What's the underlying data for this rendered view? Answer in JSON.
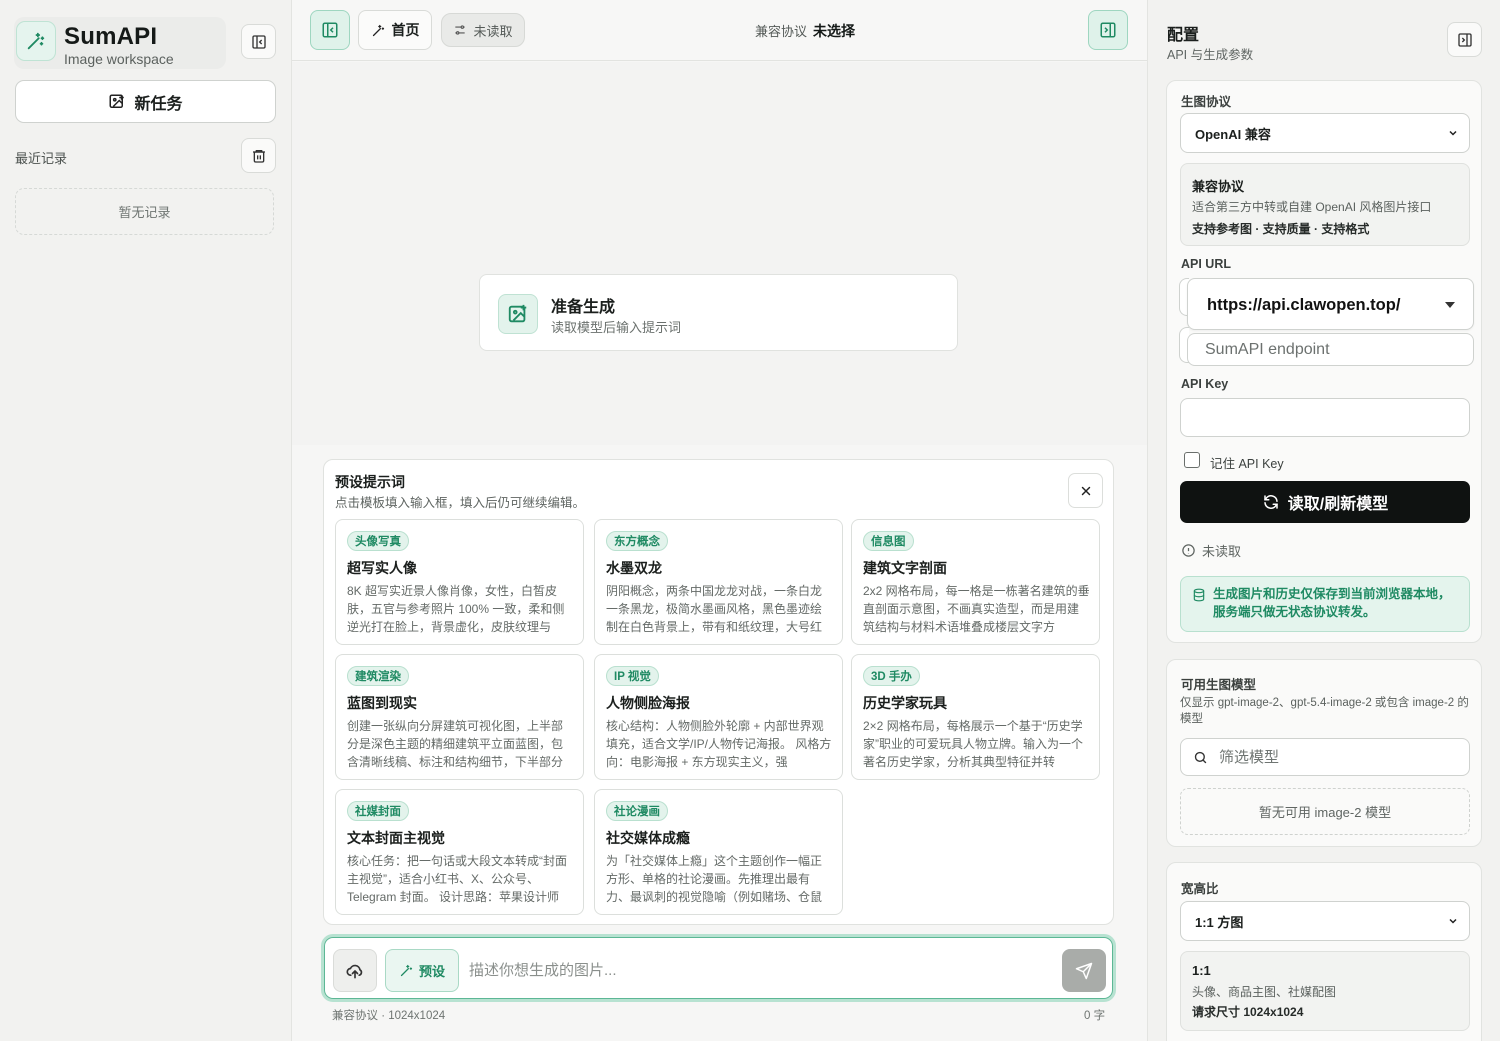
{
  "sidebar": {
    "brand_title": "SumAPI",
    "brand_subtitle": "Image workspace",
    "new_task_label": "新任务",
    "recent_label": "最近记录",
    "empty_label": "暂无记录"
  },
  "topbar": {
    "home_label": "首页",
    "status_label": "未读取",
    "protocol_label": "兼容协议",
    "protocol_value": "未选择"
  },
  "main": {
    "ready_title": "准备生成",
    "ready_subtitle": "读取模型后输入提示词"
  },
  "presets": {
    "title": "预设提示词",
    "subtitle": "点击模板填入输入框，填入后仍可继续编辑。",
    "items": [
      {
        "tag": "头像写真",
        "title": "超写实人像",
        "desc": "8K 超写实近景人像肖像，女性，白皙皮肤，五官与参考照片 100% 一致，柔和侧逆光打在脸上，背景虚化，皮肤纹理与"
      },
      {
        "tag": "东方概念",
        "title": "水墨双龙",
        "desc": "阴阳概念，两条中国龙龙对战，一条白龙一条黑龙，极简水墨画风格，黑色墨迹绘制在白色背景上，带有和纸纹理，大号红"
      },
      {
        "tag": "信息图",
        "title": "建筑文字剖面",
        "desc": "2x2 网格布局，每一格是一栋著名建筑的垂直剖面示意图，不画真实造型，而是用建筑结构与材料术语堆叠成楼层文字方"
      },
      {
        "tag": "建筑渲染",
        "title": "蓝图到现实",
        "desc": "创建一张纵向分屏建筑可视化图，上半部分是深色主题的精细建筑平立面蓝图，包含清晰线稿、标注和结构细节，下半部分"
      },
      {
        "tag": "IP 视觉",
        "title": "人物侧脸海报",
        "desc": "核心结构：人物侧脸外轮廓 + 内部世界观填充，适合文学/IP/人物传记海报。 风格方向：电影海报 + 东方现实主义，强"
      },
      {
        "tag": "3D 手办",
        "title": "历史学家玩具",
        "desc": "2×2 网格布局，每格展示一个基于“历史学家”职业的可爱玩具人物立牌。输入为一个著名历史学家，分析其典型特征并转"
      },
      {
        "tag": "社媒封面",
        "title": "文本封面主视觉",
        "desc": "核心任务：把一句话或大段文本转成“封面主视觉”，适合小红书、X、公众号、Telegram 封面。 设计思路：苹果设计师"
      },
      {
        "tag": "社论漫画",
        "title": "社交媒体成瘾",
        "desc": "为「社交媒体上瘾」这个主题创作一幅正方形、单格的社论漫画。先推理出最有力、最讽刺的视觉隐喻（例如赌场、仓鼠"
      }
    ]
  },
  "composer": {
    "preset_label": "预设",
    "placeholder": "描述你想生成的图片...",
    "footer_left": "兼容协议 · 1024x1024",
    "footer_right": "0 字"
  },
  "config": {
    "title": "配置",
    "subtitle": "API 与生成参数",
    "protocol_field": "生图协议",
    "protocol_value": "OpenAI 兼容",
    "protocol_info_title": "兼容协议",
    "protocol_info_desc": "适合第三方中转或自建 OpenAI 风格图片接口",
    "protocol_info_feats": "支持参考图 · 支持质量 · 支持格式",
    "api_url_label": "API URL",
    "api_url_value": "https://api.clawopen.top/",
    "endpoint_option": "SumAPI endpoint",
    "api_key_label": "API Key",
    "remember_label": "记住 API Key",
    "load_button": "读取/刷新模型",
    "status": "未读取",
    "note": "生成图片和历史仅保存到当前浏览器本地，服务端只做无状态协议转发。"
  },
  "models": {
    "title": "可用生图模型",
    "desc": "仅显示 gpt-image-2、gpt-5.4-image-2 或包含 image-2 的模型",
    "filter_placeholder": "筛选模型",
    "empty": "暂无可用 image-2 模型"
  },
  "aspect": {
    "title": "宽高比",
    "value": "1:1 方图",
    "info_title": "1:1",
    "info_desc": "头像、商品主图、社媒配图",
    "info_size": "请求尺寸 1024x1024"
  },
  "colors": {
    "accent": "#1f8a63",
    "accent_bg": "#e3f3ec",
    "primary_button": "#0f1211"
  }
}
